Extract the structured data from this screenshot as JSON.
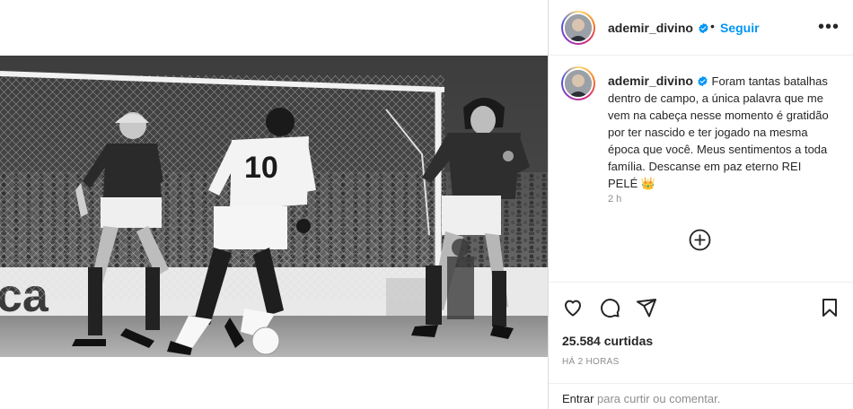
{
  "post": {
    "username": "ademir_divino",
    "follow_label": "Seguir",
    "dot_separator": "•",
    "more_label": "•••",
    "caption_username": "ademir_divino",
    "caption_text": " Foram tantas batalhas dentro de campo, a única palavra que me vem na cabeça nesse momento é gratidão por ter nascido e ter jogado na mesma época que você. Meus sentimentos a toda família. Descanse em paz eterno REI PELÉ ",
    "caption_emoji": "👑",
    "comment_age": "2 h",
    "likes": "25.584 curtidas",
    "posted": "HÁ 2 HORAS",
    "comment_login_link": "Entrar",
    "comment_prompt": " para curtir ou comentar."
  },
  "photo": {
    "jersey_number": "10"
  },
  "colors": {
    "accent": "#0095f6",
    "verified": "#0095f6",
    "text": "#262626",
    "muted": "#8e8e8e",
    "border": "#dbdbdb"
  },
  "icons": [
    "verified-icon",
    "more-options-icon",
    "add-comment-icon",
    "heart-icon",
    "comment-icon",
    "share-icon",
    "bookmark-icon"
  ]
}
